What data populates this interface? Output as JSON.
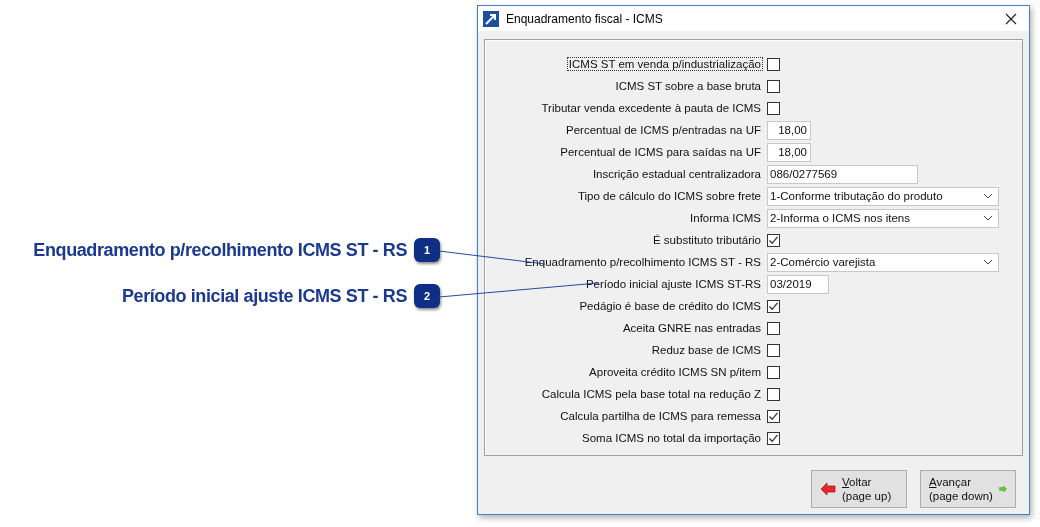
{
  "callouts": [
    {
      "number": "1",
      "text": "Enquadramento p/recolhimento ICMS ST - RS"
    },
    {
      "number": "2",
      "text": "Período inicial ajuste ICMS ST - RS"
    }
  ],
  "window": {
    "title": "Enquadramento fiscal - ICMS"
  },
  "fields": [
    {
      "label": "ICMS ST em venda p/industrialização",
      "kind": "checkbox",
      "checked": false,
      "focused": true
    },
    {
      "label": "ICMS ST sobre a base bruta",
      "kind": "checkbox",
      "checked": false,
      "focused": false
    },
    {
      "label": "Tributar venda excedente à pauta de ICMS",
      "kind": "checkbox",
      "checked": false,
      "focused": false
    },
    {
      "label": "Percentual de ICMS p/entradas na UF",
      "kind": "number",
      "value": "18,00",
      "focused": false
    },
    {
      "label": "Percentual de ICMS para saídas na UF",
      "kind": "number",
      "value": "18,00",
      "focused": false
    },
    {
      "label": "Inscrição estadual centralizadora",
      "kind": "text",
      "value": "086/0277569",
      "focused": false
    },
    {
      "label": "Tipo de cálculo do ICMS sobre frete",
      "kind": "select",
      "value": "1-Conforme tributação do produto",
      "focused": false
    },
    {
      "label": "Informa ICMS",
      "kind": "select",
      "value": "2-Informa o ICMS nos itens",
      "focused": false
    },
    {
      "label": "É substituto tributário",
      "kind": "checkbox",
      "checked": true,
      "focused": false
    },
    {
      "label": "Enquadramento p/recolhimento ICMS ST - RS",
      "kind": "select",
      "value": "2-Comércio varejista",
      "focused": false
    },
    {
      "label": "Período inicial ajuste ICMS ST-RS",
      "kind": "period",
      "value": "03/2019",
      "focused": false
    },
    {
      "label": "Pedágio é base de crédito do ICMS",
      "kind": "checkbox",
      "checked": true,
      "focused": false
    },
    {
      "label": "Aceita GNRE nas entradas",
      "kind": "checkbox",
      "checked": false,
      "focused": false
    },
    {
      "label": "Reduz base de ICMS",
      "kind": "checkbox",
      "checked": false,
      "focused": false
    },
    {
      "label": "Aproveita crédito ICMS SN p/item",
      "kind": "checkbox",
      "checked": false,
      "focused": false
    },
    {
      "label": "Calcula ICMS pela base total na redução Z",
      "kind": "checkbox",
      "checked": false,
      "focused": false
    },
    {
      "label": "Calcula partilha de ICMS para remessa",
      "kind": "checkbox",
      "checked": true,
      "focused": false
    },
    {
      "label": "Soma ICMS no total da importação",
      "kind": "checkbox",
      "checked": true,
      "focused": false
    }
  ],
  "buttons": [
    {
      "kind": "back",
      "label": "Voltar",
      "hint": "(page up)"
    },
    {
      "kind": "next",
      "label": "Avançar",
      "hint": "(page down)"
    }
  ]
}
